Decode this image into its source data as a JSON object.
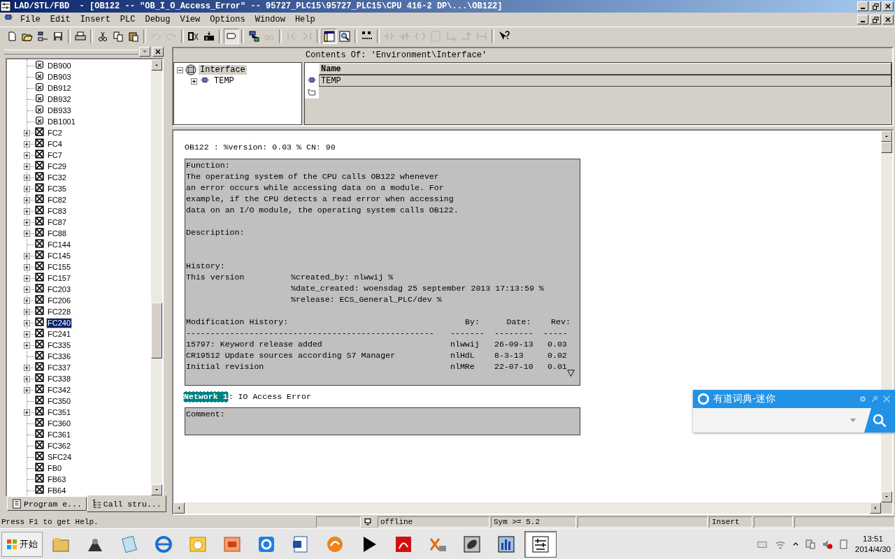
{
  "window": {
    "title": "LAD/STL/FBD  - [OB122 -- \"OB_I_O_Access_Error\" -- 95727_PLC15\\95727_PLC15\\CPU 416-2 DP\\...\\OB122]"
  },
  "menu": [
    "File",
    "Edit",
    "Insert",
    "PLC",
    "Debug",
    "View",
    "Options",
    "Window",
    "Help"
  ],
  "toolbar": [
    {
      "kind": "new",
      "disabled": false,
      "pressed": false
    },
    {
      "kind": "open",
      "disabled": false,
      "pressed": false
    },
    {
      "kind": "nodes",
      "disabled": false,
      "pressed": false
    },
    {
      "kind": "save",
      "disabled": false,
      "pressed": false
    },
    {
      "kind": "sep"
    },
    {
      "kind": "print",
      "disabled": false,
      "pressed": false
    },
    {
      "kind": "sep"
    },
    {
      "kind": "cut",
      "disabled": false,
      "pressed": false
    },
    {
      "kind": "copy",
      "disabled": false,
      "pressed": false
    },
    {
      "kind": "paste",
      "disabled": false,
      "pressed": false
    },
    {
      "kind": "sep"
    },
    {
      "kind": "undo",
      "disabled": true,
      "pressed": false
    },
    {
      "kind": "redo",
      "disabled": true,
      "pressed": false
    },
    {
      "kind": "sep"
    },
    {
      "kind": "compile",
      "disabled": false,
      "pressed": false
    },
    {
      "kind": "download",
      "disabled": false,
      "pressed": false
    },
    {
      "kind": "sep"
    },
    {
      "kind": "comment",
      "disabled": false,
      "pressed": true
    },
    {
      "kind": "sep"
    },
    {
      "kind": "network",
      "disabled": false,
      "pressed": false
    },
    {
      "kind": "monitor",
      "disabled": true,
      "pressed": false
    },
    {
      "kind": "sep"
    },
    {
      "kind": "prev-error",
      "disabled": true,
      "pressed": false
    },
    {
      "kind": "next-error",
      "disabled": true,
      "pressed": false
    },
    {
      "kind": "sep"
    },
    {
      "kind": "overview",
      "disabled": false,
      "pressed": true
    },
    {
      "kind": "details",
      "disabled": false,
      "pressed": false
    },
    {
      "kind": "sep"
    },
    {
      "kind": "io",
      "disabled": false,
      "pressed": false
    },
    {
      "kind": "sep"
    },
    {
      "kind": "contact-no",
      "disabled": true,
      "pressed": false
    },
    {
      "kind": "contact-nc",
      "disabled": true,
      "pressed": false
    },
    {
      "kind": "coil",
      "disabled": true,
      "pressed": false
    },
    {
      "kind": "empty-box",
      "disabled": true,
      "pressed": false
    },
    {
      "kind": "branch-open",
      "disabled": true,
      "pressed": false
    },
    {
      "kind": "branch-close",
      "disabled": true,
      "pressed": false
    },
    {
      "kind": "connection",
      "disabled": true,
      "pressed": false
    },
    {
      "kind": "sep"
    },
    {
      "kind": "help",
      "disabled": false,
      "pressed": false
    }
  ],
  "tree": [
    {
      "label": "DB900",
      "kind": "db",
      "expandable": false,
      "selected": false
    },
    {
      "label": "DB903",
      "kind": "db",
      "expandable": false,
      "selected": false
    },
    {
      "label": "DB912",
      "kind": "db",
      "expandable": false,
      "selected": false
    },
    {
      "label": "DB932",
      "kind": "db",
      "expandable": false,
      "selected": false
    },
    {
      "label": "DB933",
      "kind": "db",
      "expandable": false,
      "selected": false
    },
    {
      "label": "DB1001",
      "kind": "db",
      "expandable": false,
      "selected": false
    },
    {
      "label": "FC2",
      "kind": "fc",
      "expandable": true,
      "selected": false
    },
    {
      "label": "FC4",
      "kind": "fc",
      "expandable": true,
      "selected": false
    },
    {
      "label": "FC7",
      "kind": "fc",
      "expandable": true,
      "selected": false
    },
    {
      "label": "FC29",
      "kind": "fc",
      "expandable": true,
      "selected": false
    },
    {
      "label": "FC32",
      "kind": "fc",
      "expandable": true,
      "selected": false
    },
    {
      "label": "FC35",
      "kind": "fc",
      "expandable": true,
      "selected": false
    },
    {
      "label": "FC82",
      "kind": "fc",
      "expandable": true,
      "selected": false
    },
    {
      "label": "FC83",
      "kind": "fc",
      "expandable": true,
      "selected": false
    },
    {
      "label": "FC87",
      "kind": "fc",
      "expandable": true,
      "selected": false
    },
    {
      "label": "FC88",
      "kind": "fc",
      "expandable": true,
      "selected": false
    },
    {
      "label": "FC144",
      "kind": "fc",
      "expandable": false,
      "selected": false
    },
    {
      "label": "FC145",
      "kind": "fc",
      "expandable": true,
      "selected": false
    },
    {
      "label": "FC155",
      "kind": "fc",
      "expandable": true,
      "selected": false
    },
    {
      "label": "FC157",
      "kind": "fc",
      "expandable": true,
      "selected": false
    },
    {
      "label": "FC203",
      "kind": "fc",
      "expandable": true,
      "selected": false
    },
    {
      "label": "FC206",
      "kind": "fc",
      "expandable": true,
      "selected": false
    },
    {
      "label": "FC228",
      "kind": "fc",
      "expandable": true,
      "selected": false
    },
    {
      "label": "FC240",
      "kind": "fc",
      "expandable": true,
      "selected": true
    },
    {
      "label": "FC241",
      "kind": "fc",
      "expandable": true,
      "selected": false
    },
    {
      "label": "FC335",
      "kind": "fc",
      "expandable": true,
      "selected": false
    },
    {
      "label": "FC336",
      "kind": "fc",
      "expandable": false,
      "selected": false
    },
    {
      "label": "FC337",
      "kind": "fc",
      "expandable": true,
      "selected": false
    },
    {
      "label": "FC338",
      "kind": "fc",
      "expandable": true,
      "selected": false
    },
    {
      "label": "FC342",
      "kind": "fc",
      "expandable": true,
      "selected": false
    },
    {
      "label": "FC350",
      "kind": "fc",
      "expandable": false,
      "selected": false
    },
    {
      "label": "FC351",
      "kind": "fc",
      "expandable": true,
      "selected": false
    },
    {
      "label": "FC360",
      "kind": "fc",
      "expandable": false,
      "selected": false
    },
    {
      "label": "FC361",
      "kind": "fc",
      "expandable": false,
      "selected": false
    },
    {
      "label": "FC362",
      "kind": "fc",
      "expandable": false,
      "selected": false
    },
    {
      "label": "SFC24",
      "kind": "fc",
      "expandable": false,
      "selected": false
    },
    {
      "label": "FB0",
      "kind": "fc",
      "expandable": false,
      "selected": false
    },
    {
      "label": "FB63",
      "kind": "fc",
      "expandable": false,
      "selected": false
    },
    {
      "label": "FB64",
      "kind": "fc",
      "expandable": false,
      "selected": false
    }
  ],
  "left_tabs": [
    {
      "label": "Program e...",
      "selected": false
    },
    {
      "label": "Call stru...",
      "selected": true
    }
  ],
  "interface_tree": [
    {
      "label": "Interface",
      "expanded": true,
      "selected": true,
      "children": [
        {
          "label": "TEMP",
          "expanded": false,
          "selected": false
        }
      ]
    }
  ],
  "contents": {
    "title": "Contents Of: 'Environment\\Interface'",
    "column": "Name",
    "rows": [
      {
        "label": "TEMP"
      }
    ]
  },
  "editor": {
    "header": "OB122 : %version: 0.03 % CN: 90",
    "block_comment": {
      "function": {
        "heading": "Function:",
        "lines": [
          "The operating system of the CPU calls OB122 whenever",
          "an error occurs while accessing data on a module. For",
          "example, if the CPU detects a read error when accessing",
          "data on an I/O module, the operating system calls OB122."
        ]
      },
      "description": {
        "heading": "Description:"
      },
      "history": {
        "heading": "History:",
        "label": "This version",
        "lines": [
          "%created_by: nlwwij %",
          "%date_created: woensdag 25 september 2013 17:13:59 %",
          "%release: ECS_General_PLC/dev %"
        ]
      },
      "modifications": {
        "columns": [
          {
            "label": "Modification History:",
            "rule": "---------------------------------------------------"
          },
          {
            "label": "By:",
            "rule": "-------"
          },
          {
            "label": "Date:",
            "rule": "--------"
          },
          {
            "label": "Rev:",
            "rule": "-----"
          }
        ],
        "rows": [
          [
            "15797: Keyword release added",
            "nlwwij",
            "26-09-13",
            "0.03"
          ],
          [
            "CR19512 Update sources according S7 Manager",
            "nlHdL",
            "8-3-13",
            "0.02"
          ],
          [
            "Initial revision",
            "nlMRe",
            "22-07-10",
            "0.01"
          ]
        ]
      }
    },
    "networks": [
      {
        "label": "Network 1",
        "title": ": IO Access Error",
        "comment": "Comment:",
        "selected": true
      }
    ]
  },
  "status_bar": {
    "help": "Press F1 to get Help.",
    "mode": "offline",
    "version": "Sym >= 5.2",
    "insert": "Insert"
  },
  "dictionary": {
    "title": "有道词典-迷你"
  },
  "taskbar": {
    "start": "开始",
    "apps": [
      {
        "kind": "folder",
        "selected": false
      },
      {
        "kind": "tool",
        "selected": false
      },
      {
        "kind": "notepad",
        "selected": false
      },
      {
        "kind": "browser",
        "selected": false
      },
      {
        "kind": "mail",
        "selected": false
      },
      {
        "kind": "slides",
        "selected": false
      },
      {
        "kind": "dictionary",
        "selected": false
      },
      {
        "kind": "document",
        "selected": false
      },
      {
        "kind": "fox",
        "selected": false
      },
      {
        "kind": "player",
        "selected": false
      },
      {
        "kind": "pdf",
        "selected": false
      },
      {
        "kind": "xml",
        "selected": false
      },
      {
        "kind": "wrench",
        "selected": false
      },
      {
        "kind": "chart",
        "selected": false
      },
      {
        "kind": "ladder",
        "selected": true
      }
    ],
    "time": "13:51",
    "date": "2014/4/30"
  }
}
